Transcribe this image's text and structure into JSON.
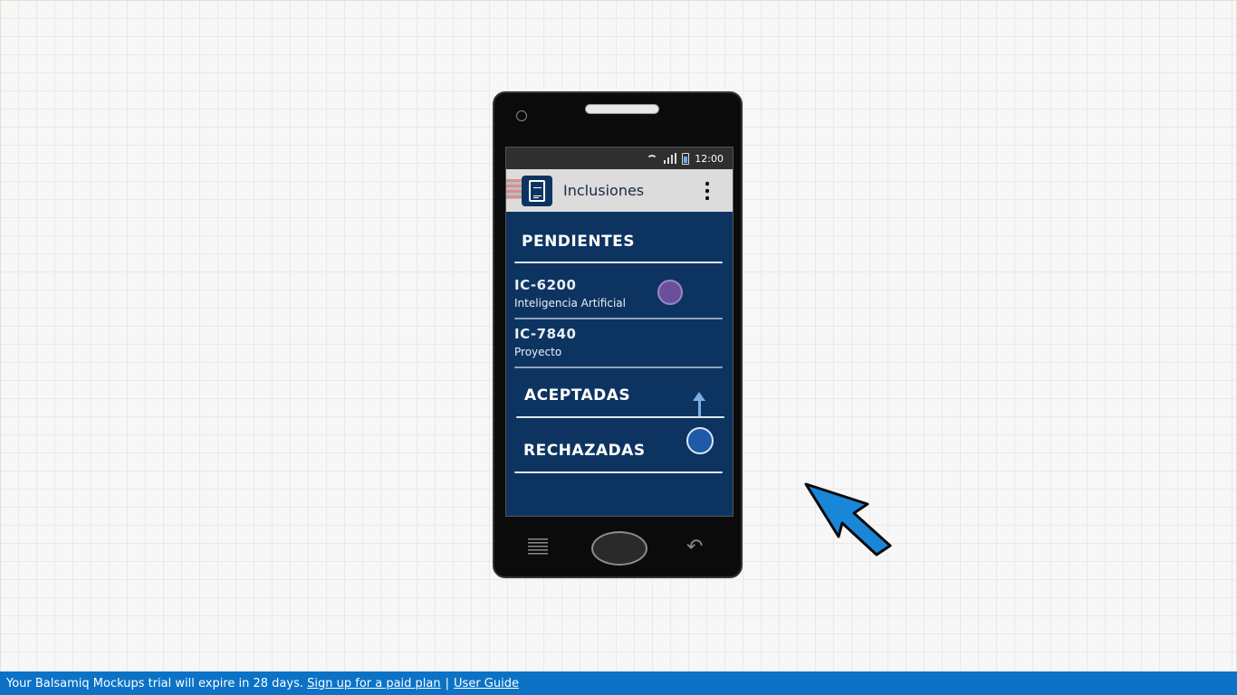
{
  "statusbar": {
    "time": "12:00"
  },
  "app": {
    "title": "Inclusiones"
  },
  "sections": {
    "pending": "PENDIENTES",
    "accepted": "ACEPTADAS",
    "rejected": "RECHAZADAS"
  },
  "pending_items": [
    {
      "code": "IC-6200",
      "subject": "Inteligencia Artificial"
    },
    {
      "code": "IC-7840",
      "subject": "Proyecto"
    }
  ],
  "footer": {
    "message": "Your Balsamiq Mockups trial will expire in 28 days.",
    "signup_link": "Sign up for a paid plan",
    "separator": "|",
    "guide_link": "User Guide"
  },
  "colors": {
    "screen_bg": "#0d3461",
    "appbar_bg": "#dcdcdc",
    "footer_bg": "#0b72c6",
    "cursor": "#1a86d8"
  },
  "icons": [
    "document-icon",
    "overflow-menu-icon",
    "wifi-icon",
    "signal-icon",
    "battery-icon",
    "menu-key-icon",
    "back-key-icon",
    "arrow-cursor-icon"
  ]
}
